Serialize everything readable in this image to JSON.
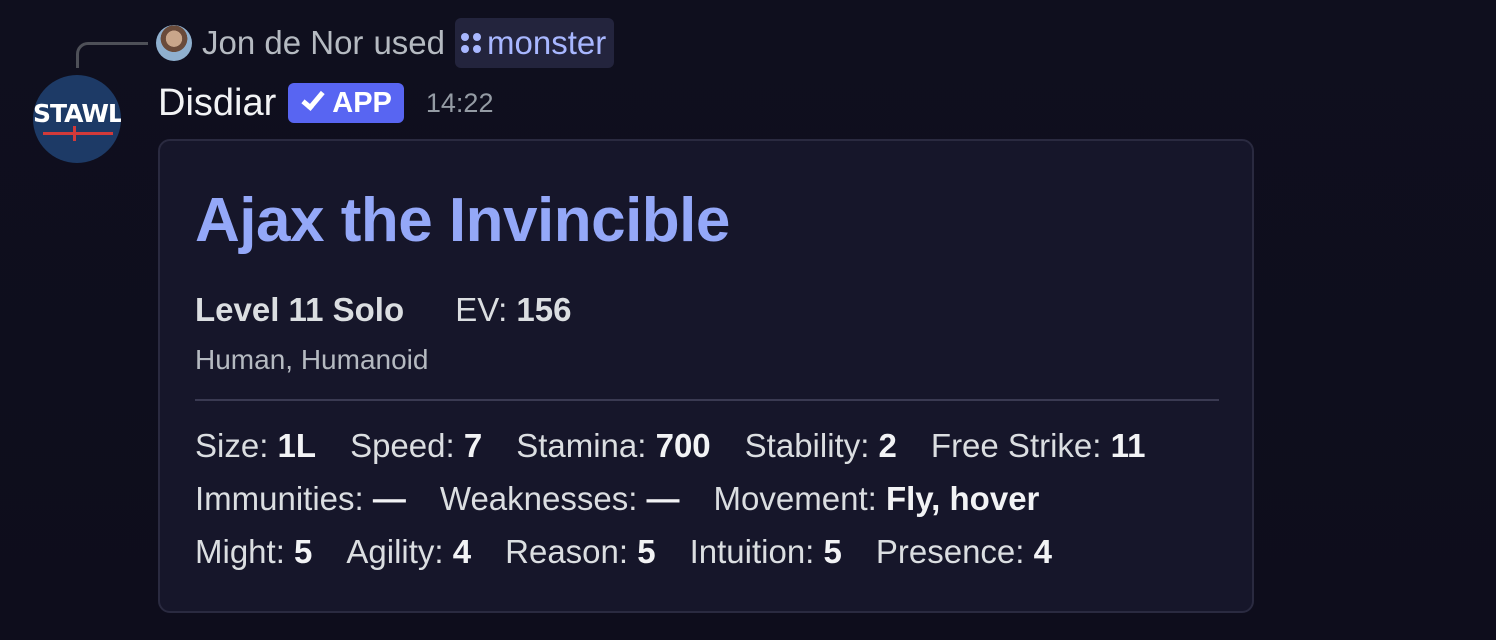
{
  "reply": {
    "user_name": "Jon de Nor",
    "used_text": "used",
    "command_name": "monster"
  },
  "bot": {
    "name": "Disdiar",
    "badge": "APP",
    "timestamp": "14:22",
    "avatar_text": "STAWL"
  },
  "embed": {
    "title": "Ajax the Invincible",
    "level": "Level 11 Solo",
    "ev_label": "EV:",
    "ev_value": "156",
    "ancestry": "Human, Humanoid",
    "row1": [
      {
        "label": "Size:",
        "value": "1L"
      },
      {
        "label": "Speed:",
        "value": "7"
      },
      {
        "label": "Stamina:",
        "value": "700"
      },
      {
        "label": "Stability:",
        "value": "2"
      },
      {
        "label": "Free Strike:",
        "value": "11"
      }
    ],
    "row2": [
      {
        "label": "Immunities:",
        "value": "—"
      },
      {
        "label": "Weaknesses:",
        "value": "—"
      },
      {
        "label": "Movement:",
        "value": "Fly, hover"
      }
    ],
    "row3": [
      {
        "label": "Might:",
        "value": "5"
      },
      {
        "label": "Agility:",
        "value": "4"
      },
      {
        "label": "Reason:",
        "value": "5"
      },
      {
        "label": "Intuition:",
        "value": "5"
      },
      {
        "label": "Presence:",
        "value": "4"
      }
    ]
  },
  "colors": {
    "background": "#0f0f1e",
    "embed_bg": "#16162a",
    "title": "#94a8f8",
    "app_badge": "#5865f2",
    "command_chip_text": "#a8b7ff"
  },
  "icons": {
    "command": "command-grid-icon",
    "badge_check": "checkmark-icon"
  }
}
